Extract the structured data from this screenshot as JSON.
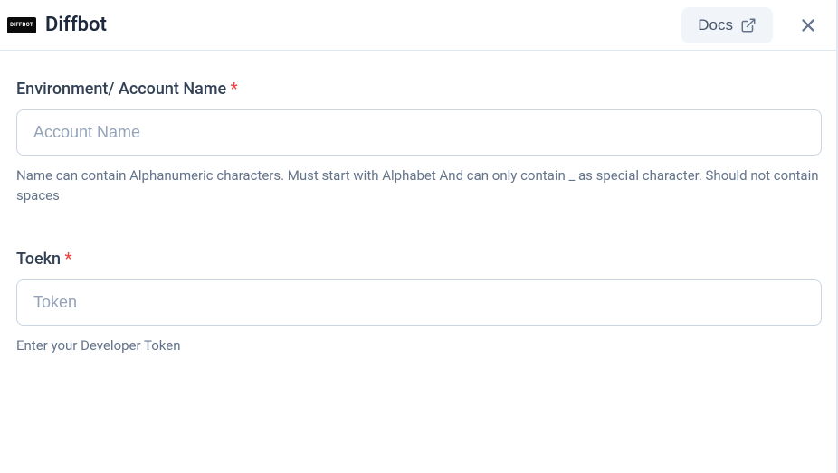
{
  "header": {
    "logo_text": "DIFFBOT",
    "title": "Diffbot",
    "docs_label": "Docs"
  },
  "form": {
    "account_name": {
      "label": "Environment/ Account Name",
      "required_mark": "*",
      "placeholder": "Account Name",
      "value": "",
      "help": "Name can contain Alphanumeric characters. Must start with Alphabet And can only contain _ as special character. Should not contain spaces"
    },
    "token": {
      "label": "Toekn",
      "required_mark": "*",
      "placeholder": "Token",
      "value": "",
      "help": "Enter your Developer Token"
    }
  }
}
